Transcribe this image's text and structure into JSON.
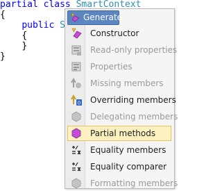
{
  "code": {
    "line1_kw": "partial class",
    "line1_name": "SmartContext",
    "line2": "{",
    "line3_kw": "public",
    "line3_name": "Smar",
    "line4": "{",
    "line5": "}",
    "line6": "}"
  },
  "menu": {
    "header_label": "Generate",
    "items": [
      {
        "label": "Constructor",
        "icon": "constructor-icon",
        "enabled": true
      },
      {
        "label": "Read-only properties",
        "icon": "read-only-properties-icon",
        "enabled": false
      },
      {
        "label": "Properties",
        "icon": "properties-icon",
        "enabled": false
      },
      {
        "label": "Missing members",
        "icon": "missing-members-icon",
        "enabled": false
      },
      {
        "label": "Overriding members",
        "icon": "overriding-members-icon",
        "enabled": true
      },
      {
        "label": "Delegating members",
        "icon": "delegating-members-icon",
        "enabled": false
      },
      {
        "label": "Partial methods",
        "icon": "partial-methods-icon",
        "enabled": true,
        "selected": true
      },
      {
        "label": "Equality members",
        "icon": "equality-members-icon",
        "enabled": true
      },
      {
        "label": "Equality comparer",
        "icon": "equality-comparer-icon",
        "enabled": true
      },
      {
        "label": "Formatting members",
        "icon": "formatting-members-icon",
        "enabled": false
      }
    ]
  },
  "colors": {
    "keyword": "#0000ff",
    "type": "#2b91af",
    "header_bg": "#5b86c2",
    "selected_bg": "#fdf1c0",
    "selected_border": "#e5c365",
    "method_purple": "#c74bd6"
  }
}
